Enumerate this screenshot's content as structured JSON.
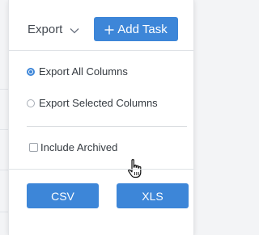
{
  "toolbar": {
    "export_label": "Export",
    "add_task_label": "Add Task"
  },
  "export_options": {
    "all_columns_label": "Export All Columns",
    "all_columns_selected": true,
    "selected_columns_label": "Export Selected Columns",
    "selected_columns_selected": false
  },
  "include_archived": {
    "label": "Include Archived",
    "checked": false
  },
  "format_buttons": {
    "csv_label": "CSV",
    "xls_label": "XLS"
  },
  "colors": {
    "accent": "#3d86d8",
    "panel_bg": "#ffffff",
    "page_bg": "#f3f4f6"
  },
  "icons": {
    "dropdown": "chevron-down-icon",
    "add": "plus-icon",
    "pointer": "hand-cursor-icon"
  }
}
